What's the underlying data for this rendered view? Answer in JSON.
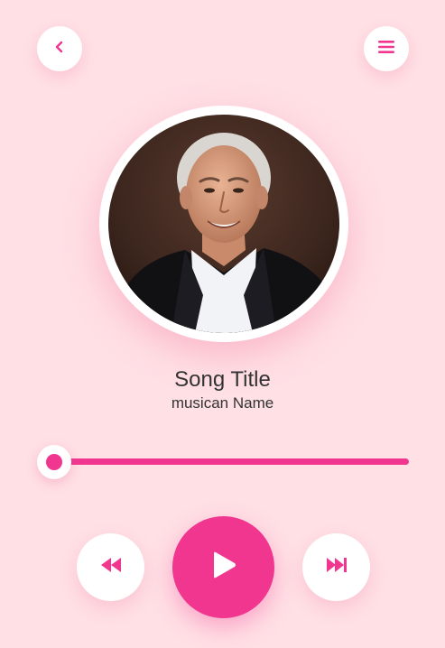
{
  "header": {
    "back_icon": "chevron-left-icon",
    "menu_icon": "hamburger-menu-icon"
  },
  "track": {
    "title": "Song Title",
    "artist": "musican Name",
    "progress": 0
  },
  "controls": {
    "rewind_icon": "rewind-icon",
    "play_icon": "play-icon",
    "forward_icon": "fast-forward-icon"
  },
  "colors": {
    "background": "#ffe0e5",
    "accent": "#f0368f",
    "button": "#ffffff",
    "text": "#333333"
  }
}
